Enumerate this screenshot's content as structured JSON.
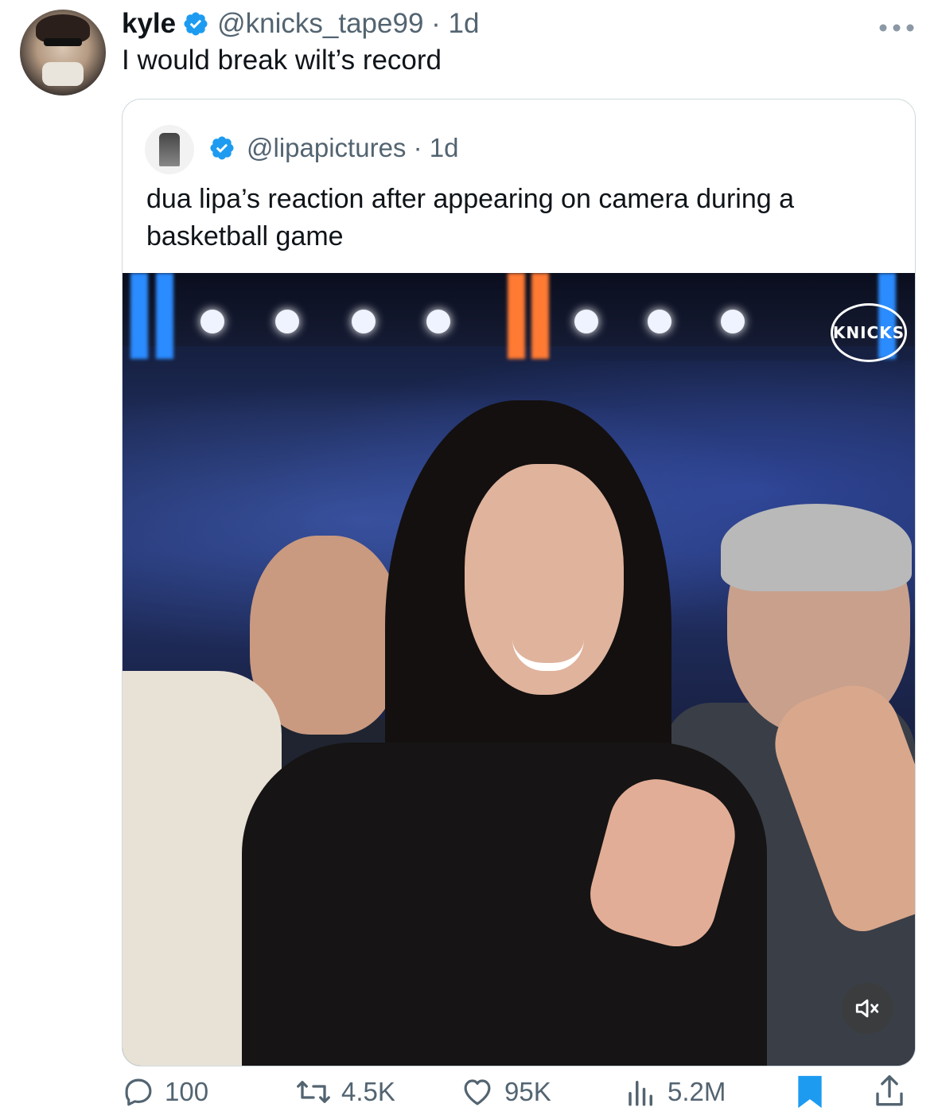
{
  "tweet": {
    "author_name": "kyle",
    "author_handle": "@knicks_tape99",
    "timestamp": "1d",
    "text": "I would break wilt’s record"
  },
  "quote": {
    "handle": "@lipapictures",
    "timestamp": "1d",
    "text": "dua lipa’s reaction after appearing on camera during a basketball game",
    "media_logo": "KNICKS"
  },
  "actions": {
    "replies": "100",
    "retweets": "4.5K",
    "likes": "95K",
    "views": "5.2M"
  },
  "colors": {
    "verified": "#1d9bf0",
    "secondary_text": "#536471",
    "bookmark_active": "#1d9bf0",
    "border": "#cfd9de"
  },
  "icons": [
    "more-icon",
    "verified-badge-icon",
    "reply-icon",
    "retweet-icon",
    "like-icon",
    "views-icon",
    "bookmark-icon",
    "share-icon",
    "mute-icon"
  ]
}
